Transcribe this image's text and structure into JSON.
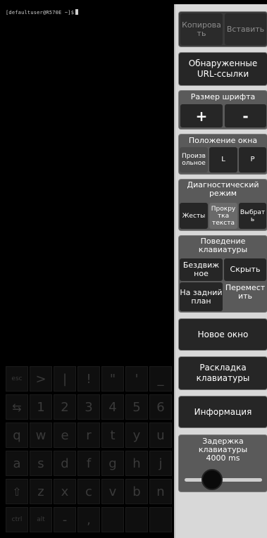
{
  "terminal": {
    "prompt": "[defaultuser@R570E ~]$"
  },
  "keyboard": {
    "rows": [
      [
        "esc",
        ">",
        "|",
        "!",
        "\"",
        "'",
        "_"
      ],
      [
        "⇆",
        "1",
        "2",
        "3",
        "4",
        "5",
        "6"
      ],
      [
        "q",
        "w",
        "e",
        "r",
        "t",
        "y",
        "u"
      ],
      [
        "a",
        "s",
        "d",
        "f",
        "g",
        "h",
        "j"
      ],
      [
        "⇧",
        "z",
        "x",
        "c",
        "v",
        "b",
        "n"
      ],
      [
        "ctrl",
        "alt",
        "-",
        ",",
        "",
        "",
        ""
      ]
    ]
  },
  "panel": {
    "copy_label": "Копирова ть",
    "paste_label": "Вставить",
    "urls_label": "Обнаруженные URL-ссылки",
    "font_size": {
      "title": "Размер шрифта",
      "plus": "+",
      "minus": "-"
    },
    "window_position": {
      "title": "Положение окна",
      "free": "Произв ольное",
      "left": "L",
      "right": "P"
    },
    "diagnostic": {
      "title": "Диагностический режим",
      "gestures": "Жесты",
      "scroll": "Прокру тка текста",
      "select": "Выбрат ь"
    },
    "keyboard_behavior": {
      "title": "Поведение клавиатуры",
      "fixed": "Бездвиж ное",
      "hide": "Скрыть",
      "background": "На задний план",
      "move": "Перемест ить"
    },
    "new_window": "Новое окно",
    "layout": "Раскладка клавиатуры",
    "info": "Информация",
    "delay": {
      "title": "Задержка клавиатуры",
      "value": "4000 ms",
      "slider_fraction": 0.3
    }
  }
}
